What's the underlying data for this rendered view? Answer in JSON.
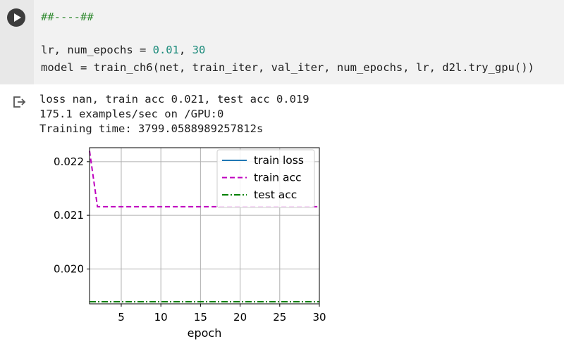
{
  "cell": {
    "comment": "##----##",
    "line1": {
      "prefix": "lr, num_epochs = ",
      "lr": "0.01",
      "sep": ", ",
      "epochs": "30"
    },
    "line2": "model = train_ch6(net, train_iter, val_iter, num_epochs, lr, d2l.try_gpu())"
  },
  "output": {
    "lines": [
      "loss nan, train acc 0.021, test acc 0.019",
      "175.1 examples/sec on /GPU:0",
      "Training time: 3799.0588989257812s"
    ]
  },
  "colors": {
    "train_loss": "#1f77b4",
    "train_acc": "#bf00bf",
    "test_acc": "#007f00"
  },
  "icons": {
    "run": "play-icon",
    "output": "output-arrow-icon"
  },
  "chart_data": {
    "type": "line",
    "xlabel": "epoch",
    "ylabel": "",
    "xlim": [
      1,
      30
    ],
    "ylim": [
      0.01935,
      0.02226
    ],
    "x_ticks": [
      5,
      10,
      15,
      20,
      25,
      30
    ],
    "x_tick_labels": [
      "5",
      "10",
      "15",
      "20",
      "25",
      "30"
    ],
    "y_ticks": [
      0.02,
      0.021,
      0.022
    ],
    "y_tick_labels": [
      "0.020",
      "0.021",
      "0.022"
    ],
    "grid": true,
    "legend": "top-right",
    "series": [
      {
        "name": "train loss",
        "style": "solid",
        "x": [],
        "y": []
      },
      {
        "name": "train acc",
        "style": "dashed",
        "x": [
          1,
          2,
          30
        ],
        "y": [
          0.0222,
          0.02116,
          0.02116
        ]
      },
      {
        "name": "test acc",
        "style": "dashdot",
        "x": [
          1,
          30
        ],
        "y": [
          0.01939,
          0.01939
        ]
      }
    ]
  }
}
